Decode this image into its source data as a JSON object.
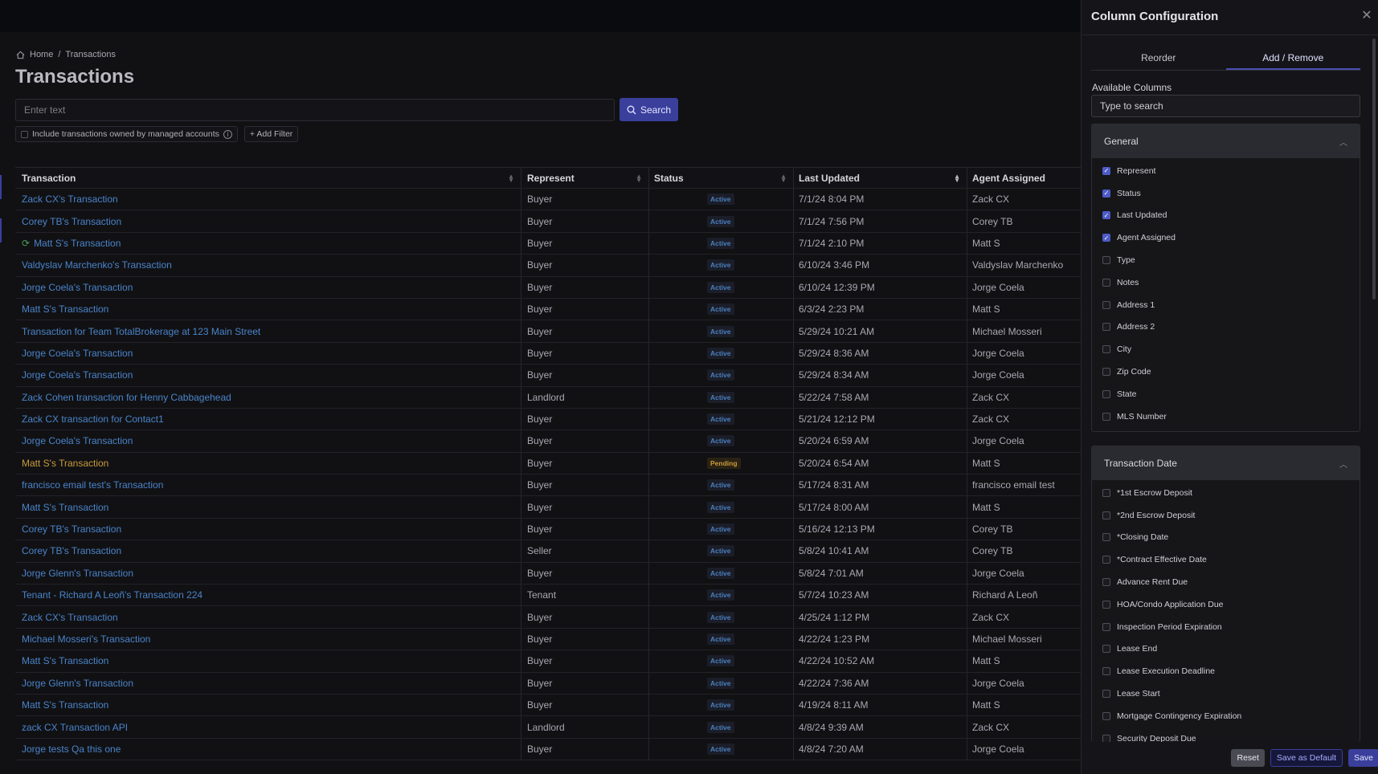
{
  "breadcrumb": {
    "home": "Home",
    "separator": "/",
    "current": "Transactions"
  },
  "page_title": "Transactions",
  "search": {
    "placeholder": "Enter text",
    "button_label": "Search"
  },
  "filters": {
    "managed_label": "Include transactions owned by managed accounts",
    "add_filter": "+ Add Filter"
  },
  "table": {
    "headers": {
      "transaction": "Transaction",
      "represent": "Represent",
      "status": "Status",
      "last_updated": "Last Updated",
      "agent": "Agent Assigned"
    },
    "rows": [
      {
        "transaction": "Zack CX's Transaction",
        "represent": "Buyer",
        "status": "Active",
        "updated": "7/1/24 8:04 PM",
        "agent": "Zack CX"
      },
      {
        "transaction": "Corey TB's Transaction",
        "represent": "Buyer",
        "status": "Active",
        "updated": "7/1/24 7:56 PM",
        "agent": "Corey TB"
      },
      {
        "transaction": "Matt S's Transaction",
        "represent": "Buyer",
        "status": "Active",
        "updated": "7/1/24 2:10 PM",
        "agent": "Matt S",
        "icon": "sync-icon"
      },
      {
        "transaction": "Valdyslav Marchenko's Transaction",
        "represent": "Buyer",
        "status": "Active",
        "updated": "6/10/24 3:46 PM",
        "agent": "Valdyslav Marchenko"
      },
      {
        "transaction": "Jorge Coela's Transaction",
        "represent": "Buyer",
        "status": "Active",
        "updated": "6/10/24 12:39 PM",
        "agent": "Jorge Coela"
      },
      {
        "transaction": "Matt S's Transaction",
        "represent": "Buyer",
        "status": "Active",
        "updated": "6/3/24 2:23 PM",
        "agent": "Matt S"
      },
      {
        "transaction": "Transaction for Team TotalBrokerage at 123 Main Street",
        "represent": "Buyer",
        "status": "Active",
        "updated": "5/29/24 10:21 AM",
        "agent": "Michael Mosseri"
      },
      {
        "transaction": "Jorge Coela's Transaction",
        "represent": "Buyer",
        "status": "Active",
        "updated": "5/29/24 8:36 AM",
        "agent": "Jorge Coela"
      },
      {
        "transaction": "Jorge Coela's Transaction",
        "represent": "Buyer",
        "status": "Active",
        "updated": "5/29/24 8:34 AM",
        "agent": "Jorge Coela"
      },
      {
        "transaction": "Zack Cohen transaction for Henny Cabbagehead",
        "represent": "Landlord",
        "status": "Active",
        "updated": "5/22/24 7:58 AM",
        "agent": "Zack CX"
      },
      {
        "transaction": "Zack CX transaction for Contact1",
        "represent": "Buyer",
        "status": "Active",
        "updated": "5/21/24 12:12 PM",
        "agent": "Zack CX"
      },
      {
        "transaction": "Jorge Coela's Transaction",
        "represent": "Buyer",
        "status": "Active",
        "updated": "5/20/24 6:59 AM",
        "agent": "Jorge Coela"
      },
      {
        "transaction": "Matt S's Transaction",
        "represent": "Buyer",
        "status": "Pending",
        "updated": "5/20/24 6:54 AM",
        "agent": "Matt S"
      },
      {
        "transaction": "francisco email test's Transaction",
        "represent": "Buyer",
        "status": "Active",
        "updated": "5/17/24 8:31 AM",
        "agent": "francisco email test"
      },
      {
        "transaction": "Matt S's Transaction",
        "represent": "Buyer",
        "status": "Active",
        "updated": "5/17/24 8:00 AM",
        "agent": "Matt S"
      },
      {
        "transaction": "Corey TB's Transaction",
        "represent": "Buyer",
        "status": "Active",
        "updated": "5/16/24 12:13 PM",
        "agent": "Corey TB"
      },
      {
        "transaction": "Corey TB's Transaction",
        "represent": "Seller",
        "status": "Active",
        "updated": "5/8/24 10:41 AM",
        "agent": "Corey TB"
      },
      {
        "transaction": "Jorge Glenn's Transaction",
        "represent": "Buyer",
        "status": "Active",
        "updated": "5/8/24 7:01 AM",
        "agent": "Jorge Coela"
      },
      {
        "transaction": "Tenant - Richard A Leoñ's Transaction 224",
        "represent": "Tenant",
        "status": "Active",
        "updated": "5/7/24 10:23 AM",
        "agent": "Richard A Leoñ"
      },
      {
        "transaction": "Zack CX's Transaction",
        "represent": "Buyer",
        "status": "Active",
        "updated": "4/25/24 1:12 PM",
        "agent": "Zack CX"
      },
      {
        "transaction": "Michael Mosseri's Transaction",
        "represent": "Buyer",
        "status": "Active",
        "updated": "4/22/24 1:23 PM",
        "agent": "Michael Mosseri"
      },
      {
        "transaction": "Matt S's Transaction",
        "represent": "Buyer",
        "status": "Active",
        "updated": "4/22/24 10:52 AM",
        "agent": "Matt S"
      },
      {
        "transaction": "Jorge Glenn's Transaction",
        "represent": "Buyer",
        "status": "Active",
        "updated": "4/22/24 7:36 AM",
        "agent": "Jorge Coela"
      },
      {
        "transaction": "Matt S's Transaction",
        "represent": "Buyer",
        "status": "Active",
        "updated": "4/19/24 8:11 AM",
        "agent": "Matt S"
      },
      {
        "transaction": "zack CX Transaction API",
        "represent": "Landlord",
        "status": "Active",
        "updated": "4/8/24 9:39 AM",
        "agent": "Zack CX"
      },
      {
        "transaction": "Jorge tests Qa this one",
        "represent": "Buyer",
        "status": "Active",
        "updated": "4/8/24 7:20 AM",
        "agent": "Jorge Coela"
      }
    ]
  },
  "panel": {
    "title": "Column Configuration",
    "tabs": {
      "reorder": "Reorder",
      "add_remove": "Add / Remove"
    },
    "available_label": "Available Columns",
    "search_placeholder": "Type to search",
    "general": {
      "title": "General",
      "options": [
        {
          "label": "Represent",
          "checked": true
        },
        {
          "label": "Status",
          "checked": true
        },
        {
          "label": "Last Updated",
          "checked": true
        },
        {
          "label": "Agent Assigned",
          "checked": true
        },
        {
          "label": "Type",
          "checked": false
        },
        {
          "label": "Notes",
          "checked": false
        },
        {
          "label": "Address 1",
          "checked": false
        },
        {
          "label": "Address 2",
          "checked": false
        },
        {
          "label": "City",
          "checked": false
        },
        {
          "label": "Zip Code",
          "checked": false
        },
        {
          "label": "State",
          "checked": false
        },
        {
          "label": "MLS Number",
          "checked": false
        }
      ]
    },
    "transaction_date": {
      "title": "Transaction Date",
      "options": [
        {
          "label": "*1st Escrow Deposit",
          "checked": false
        },
        {
          "label": "*2nd Escrow Deposit",
          "checked": false
        },
        {
          "label": "*Closing Date",
          "checked": false
        },
        {
          "label": "*Contract Effective Date",
          "checked": false
        },
        {
          "label": "Advance Rent Due",
          "checked": false
        },
        {
          "label": "HOA/Condo Application Due",
          "checked": false
        },
        {
          "label": "Inspection Period Expiration",
          "checked": false
        },
        {
          "label": "Lease End",
          "checked": false
        },
        {
          "label": "Lease Execution Deadline",
          "checked": false
        },
        {
          "label": "Lease Start",
          "checked": false
        },
        {
          "label": "Mortgage Contingency Expiration",
          "checked": false
        },
        {
          "label": "Security Deposit Due",
          "checked": false
        }
      ]
    },
    "footer": {
      "reset": "Reset",
      "save_default": "Save as Default",
      "save": "Save"
    }
  },
  "colors": {
    "accent": "#3a3f9c",
    "link": "#4a84c9",
    "pending": "#c99b38"
  }
}
